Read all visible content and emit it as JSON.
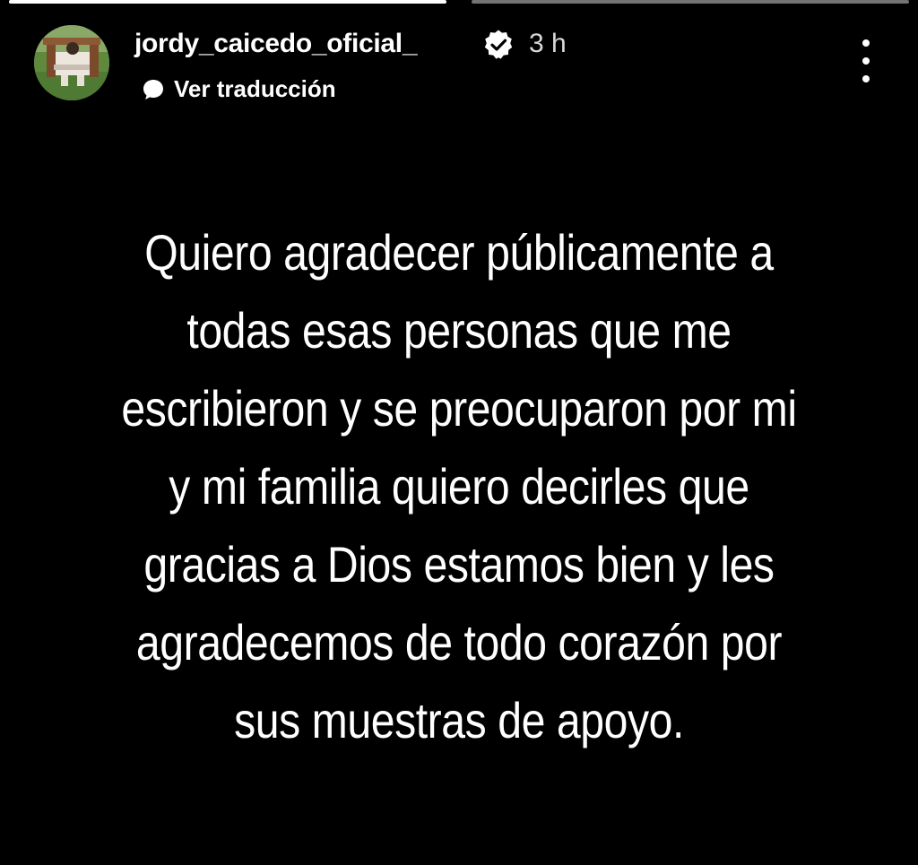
{
  "story": {
    "progress": [
      1.0,
      0.0
    ],
    "author": {
      "username": "jordy_caicedo_oficial_",
      "verified": true,
      "time_ago": "3 h",
      "avatar_icon": "profile-photo"
    },
    "translate_label": "Ver traducción",
    "menu_icon": "more-vertical-icon",
    "message_lines": [
      "Quiero agradecer públicamente  a",
      "todas esas personas que me",
      "escribieron y se preocuparon por mi",
      "y mi familia quiero decirles que",
      "gracias a Dios estamos bien y les",
      "agradecemos de todo corazón por",
      "sus muestras de apoyo."
    ]
  },
  "colors": {
    "background": "#000000",
    "text": "#ffffff",
    "muted_text": "#d8d8d8",
    "progress_track": "#737373"
  }
}
